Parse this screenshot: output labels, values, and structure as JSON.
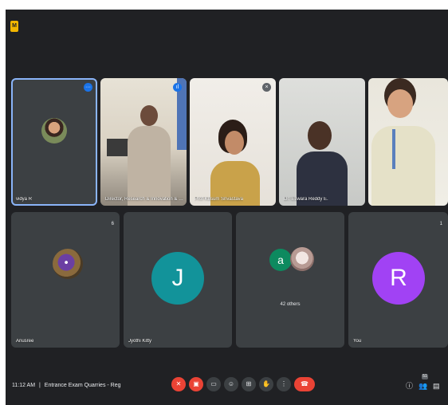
{
  "top": {
    "app_icon": "meet-logo-icon",
    "app_icon_text": "M"
  },
  "tiles": [
    {
      "name": "vidya R"
    },
    {
      "name": "Director, Research & Innovation & O..."
    },
    {
      "name": "Prof Kusum Srivastava"
    },
    {
      "name": "Dr. Eswara Reddy E."
    },
    {
      "name": ""
    },
    {
      "name": "Anusree",
      "mark": "6"
    },
    {
      "name": "Jyothi Kitty",
      "avatar_letter": "J"
    },
    {
      "name": "",
      "avatar_letter": "a",
      "others_label": "42 others"
    },
    {
      "name": "You",
      "avatar_letter": "R",
      "mark": "1"
    }
  ],
  "bottom": {
    "time": "11:12 AM",
    "separator": "|",
    "meeting_title": "Entrance Exam Quarries - Reg",
    "participants_badge": "51"
  },
  "colors": {
    "background": "#202124",
    "tile": "#3c4043",
    "active_border": "#8ab4f8",
    "end_call": "#ea4335",
    "avatar_j": "#12939a",
    "avatar_a": "#0d8a5f",
    "avatar_r": "#a142f4"
  }
}
